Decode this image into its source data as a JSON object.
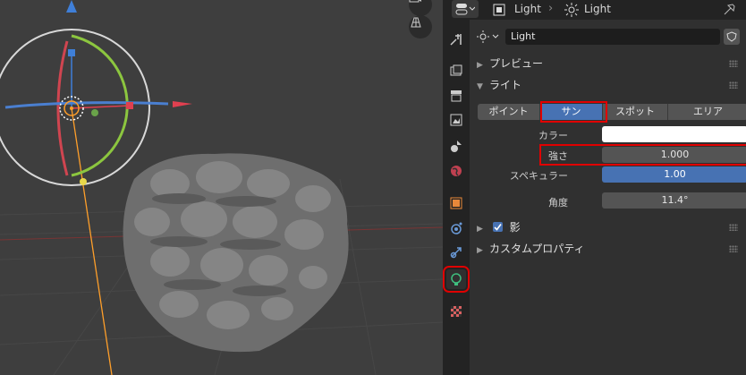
{
  "header": {
    "breadcrumb_object": "Light",
    "breadcrumb_data": "Light"
  },
  "context": {
    "datablock_name": "Light"
  },
  "panels": {
    "preview": "プレビュー",
    "light": "ライト",
    "shadow": "影",
    "custom_properties": "カスタムプロパティ"
  },
  "light_types": [
    {
      "label": "ポイント",
      "active": false
    },
    {
      "label": "サン",
      "active": true
    },
    {
      "label": "スポット",
      "active": false
    },
    {
      "label": "エリア",
      "active": false
    }
  ],
  "properties": {
    "color_label": "カラー",
    "color_value": "#ffffff",
    "strength_label": "強さ",
    "strength_value": "1.000",
    "specular_label": "スペキュラー",
    "specular_value": "1.00",
    "specular_fill": 1.0,
    "angle_label": "角度",
    "angle_value": "11.4°"
  },
  "shadow_enabled": true,
  "colors": {
    "accent_blue": "#4772b3",
    "highlight_red": "#e00000",
    "light_tab_icon": "#3fbf7f"
  },
  "tabs": [
    "tool-icon",
    "render-icon",
    "output-icon",
    "view-layer-icon",
    "scene-icon",
    "world-icon",
    "object-icon",
    "physics-icon",
    "constraints-icon",
    "light-data-icon",
    "texture-icon"
  ]
}
